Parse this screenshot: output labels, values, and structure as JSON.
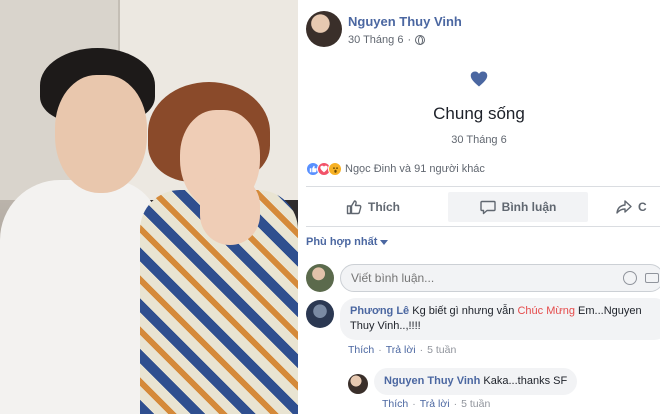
{
  "post": {
    "author": "Nguyen Thuy Vinh",
    "date": "30 Tháng 6",
    "privacy_icon": "globe-icon"
  },
  "life_event": {
    "icon": "heart-icon",
    "title": "Chung sống",
    "date": "30 Tháng 6"
  },
  "reactions": {
    "icons": [
      "like",
      "love",
      "wow"
    ],
    "summary": "Ngọc Đinh và 91 người khác"
  },
  "actions": {
    "like": "Thích",
    "comment": "Bình luận",
    "share": "C"
  },
  "comments_section": {
    "sort_label": "Phù hợp nhất",
    "composer_placeholder": "Viết bình luận...",
    "comments": [
      {
        "author": "Phương Lê",
        "text_before": "Kg biết gì nhưng vẫn",
        "highlight": "Chúc Mừng",
        "text_after": "Em...Nguyen Thuy Vinh..,!!!!",
        "like": "Thích",
        "reply": "Trả lời",
        "time": "5 tuần"
      },
      {
        "author": "Nguyen Thuy Vinh",
        "text": "Kaka...thanks SF",
        "like": "Thích",
        "reply": "Trả lời",
        "time": "5 tuần"
      }
    ]
  },
  "colors": {
    "link": "#4b67a1",
    "heart": "#4b67a1",
    "highlight": "#e54b4b"
  }
}
